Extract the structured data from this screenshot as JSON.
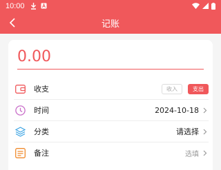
{
  "status": {
    "time": "10:00"
  },
  "header": {
    "title": "记账"
  },
  "amount": {
    "value": "0.00"
  },
  "rows": {
    "type": {
      "label": "收支",
      "income": "收入",
      "expense": "支出"
    },
    "time": {
      "label": "时间",
      "value": "2024-10-18"
    },
    "category": {
      "label": "分类",
      "value": "请选择"
    },
    "note": {
      "label": "备注",
      "value": "选填"
    }
  },
  "colors": {
    "accent": "#f0585b",
    "time_icon": "#c86cc8",
    "category_icon": "#3aa3e3",
    "note_icon": "#f08a2c"
  }
}
